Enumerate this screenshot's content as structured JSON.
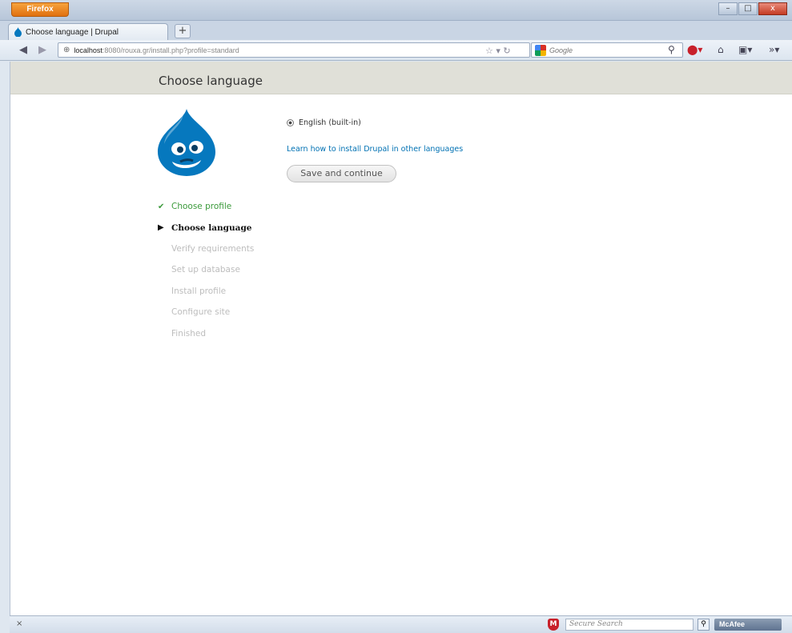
{
  "browser": {
    "menu_button": "Firefox",
    "window_buttons": {
      "minimize": "–",
      "maximize": "□",
      "close": "x"
    },
    "tab": {
      "title": "Choose language | Drupal"
    },
    "new_tab": "+",
    "url": {
      "host": "localhost",
      "rest": ":8080/rouxa.gr/install.php?profile=standard"
    },
    "search_placeholder": "Google"
  },
  "page": {
    "header_title": "Choose language",
    "steps": [
      {
        "label": "Choose profile",
        "state": "done"
      },
      {
        "label": "Choose language",
        "state": "active"
      },
      {
        "label": "Verify requirements",
        "state": "todo"
      },
      {
        "label": "Set up database",
        "state": "todo"
      },
      {
        "label": "Install profile",
        "state": "todo"
      },
      {
        "label": "Configure site",
        "state": "todo"
      },
      {
        "label": "Finished",
        "state": "todo"
      }
    ],
    "language_option": "English (built-in)",
    "learn_link": "Learn how to install Drupal in other languages",
    "save_button": "Save and continue"
  },
  "statusbar": {
    "close": "×",
    "secure_search_placeholder": "Secure Search",
    "mcafee_label": "McAfee"
  },
  "colors": {
    "drupal_blue": "#0678be",
    "link": "#0071b3",
    "done_green": "#3b9a3b",
    "header_band": "#e0e0d8"
  }
}
